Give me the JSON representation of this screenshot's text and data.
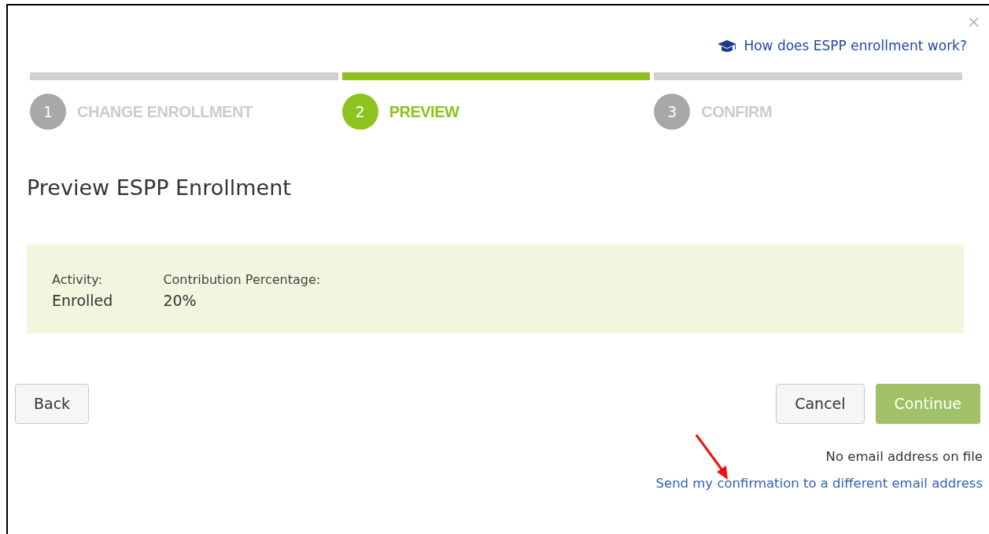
{
  "close": "×",
  "help_link": "How does ESPP enrollment work?",
  "steps": [
    {
      "number": "1",
      "label": "CHANGE ENROLLMENT",
      "selected": false
    },
    {
      "number": "2",
      "label": "PREVIEW",
      "selected": true
    },
    {
      "number": "3",
      "label": "CONFIRM",
      "selected": false
    }
  ],
  "title": "Preview ESPP Enrollment",
  "summary": [
    {
      "label": "Activity:",
      "value": "Enrolled"
    },
    {
      "label": "Contribution Percentage:",
      "value": "20%"
    }
  ],
  "buttons": {
    "back": "Back",
    "cancel": "Cancel",
    "continue": "Continue"
  },
  "email_note": "No email address on file",
  "email_link": "Send my confirmation to a different email address"
}
